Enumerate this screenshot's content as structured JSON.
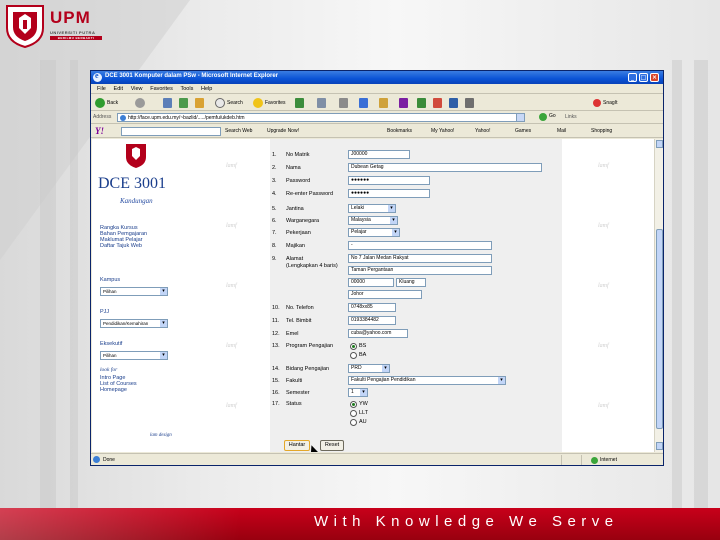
{
  "slide": {
    "logo_text": "UPM",
    "logo_subtext_1": "UNIVERSITI PUTRA MALAYSIA",
    "logo_subtext_2": "BERILMU BERBAKTI",
    "motto": "With Knowledge We Serve"
  },
  "browser": {
    "title": "DCE 3001 Komputer dalam PSw - Microsoft Internet Explorer",
    "menu": [
      "File",
      "Edit",
      "View",
      "Favorites",
      "Tools",
      "Help"
    ],
    "toolbar": {
      "back": "Back",
      "search": "Search",
      "favorites": "Favorites"
    },
    "address_label": "Address",
    "address": "http://face.upm.edu.my/~bazlid/...../pemfu/ukdeb.htm",
    "go": "Go",
    "links": "Links",
    "snagit": "SnagIt",
    "yahoo_logo": "Y!",
    "yahoo_items": [
      "Search Web",
      "Upgrade Now!",
      "Bookmarks",
      "My Yahoo!",
      "Yahoo!",
      "Games",
      "Mail",
      "Shopping"
    ],
    "status": "Done",
    "zone": "Internet"
  },
  "page": {
    "watermark": "lamf",
    "course_title": "DCE 3001",
    "subtitle": "Kandungan",
    "nav_links": [
      "Rangka Kursus",
      "Bahan Pemgajaran",
      "Maklumat Pelajar",
      "Daftar Tajuk Web"
    ],
    "kampus_label": "Kampus",
    "kampus_value": "Pilihan",
    "psu_label": "PJJ",
    "psu_value": "Pendidikan/Kemahiran",
    "eksekutif_label": "Eksekutif",
    "eksekutif_value": "Pilihan",
    "look_for": "look for",
    "extra_links": [
      "Intro Page",
      "List of Courses",
      "Homepage"
    ],
    "design_credit": "lam design"
  },
  "form": {
    "rows": [
      {
        "num": "1.",
        "label": "No Matrik",
        "value": "J00000"
      },
      {
        "num": "2.",
        "label": "Nama",
        "value": "Dubean Getag"
      },
      {
        "num": "3.",
        "label": "Password",
        "value": "●●●●●●"
      },
      {
        "num": "4.",
        "label": "Re-enter Password",
        "value": "●●●●●●"
      },
      {
        "num": "5.",
        "label": "Jantina",
        "value": "Lelaki"
      },
      {
        "num": "6.",
        "label": "Warganegara",
        "value": "Malaysia"
      },
      {
        "num": "7.",
        "label": "Pekerjaan",
        "value": "Pelajar"
      },
      {
        "num": "8.",
        "label": "Majikan",
        "value": "-"
      },
      {
        "num": "9.",
        "label": "Alamat",
        "sublabel": "(Lengkapkan 4 baris)",
        "lines": [
          "No 7 Jalan Medan Rakyat",
          "Taman Pergantaan",
          "00000",
          "Johor"
        ],
        "city": "Kluang"
      },
      {
        "num": "10.",
        "label": "No. Telefon",
        "value": "0748xx85"
      },
      {
        "num": "11.",
        "label": "Tel. Bimbit",
        "value": "0193384482"
      },
      {
        "num": "12.",
        "label": "Emel",
        "value": "cuba@yahoo.com"
      },
      {
        "num": "13.",
        "label": "Program Pengajian",
        "options": [
          "BS",
          "BA"
        ]
      },
      {
        "num": "14.",
        "label": "Bidang Pengajian",
        "value": "PRD"
      },
      {
        "num": "15.",
        "label": "Fakulti",
        "value": "Fakulti Pengajian Pendidikan"
      },
      {
        "num": "16.",
        "label": "Semester",
        "value": "1"
      },
      {
        "num": "17.",
        "label": "Status",
        "options": [
          "YW",
          "LLT",
          "AU"
        ]
      }
    ],
    "submit": "Hantar",
    "reset": "Reset"
  },
  "colors": {
    "brand_red": "#b3001b",
    "xp_blue": "#0a53d6",
    "link_blue": "#1a3e8c"
  }
}
